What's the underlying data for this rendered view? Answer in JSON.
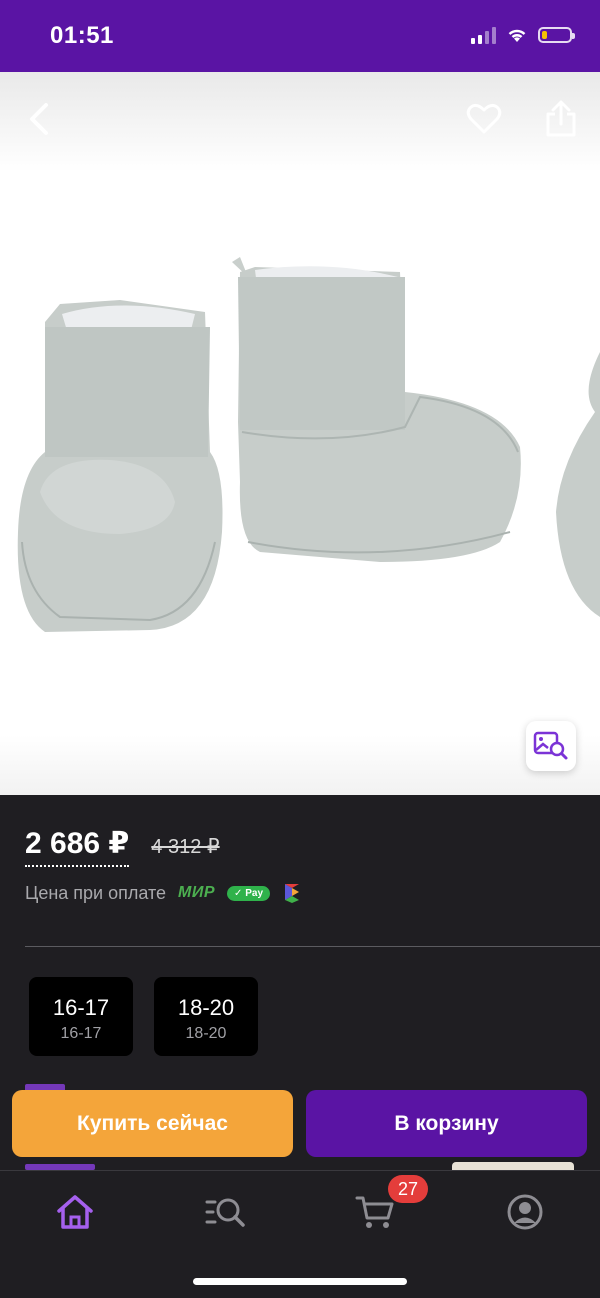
{
  "status_bar": {
    "time": "01:51",
    "battery_level": 0.2,
    "color": "#5a14a4"
  },
  "icons": {
    "back": "chevron-left-icon",
    "favorite": "heart-icon",
    "share": "share-icon",
    "visual_search": "image-search-icon",
    "tabs": [
      "home-icon",
      "catalog-search-icon",
      "cart-icon",
      "profile-icon"
    ]
  },
  "product": {
    "price_current": "2 686 ₽",
    "price_old": "4 312 ₽",
    "pay_caption": "Цена при оплате",
    "payment_methods": {
      "mir": "МИР",
      "sbp_pay": "Pay"
    }
  },
  "sizes": [
    {
      "label": "16-17",
      "sublabel": "16-17"
    },
    {
      "label": "18-20",
      "sublabel": "18-20"
    }
  ],
  "actions": {
    "buy_now": "Купить сейчас",
    "add_to_cart": "В корзину"
  },
  "tab_bar": {
    "cart_count": "27",
    "active_tab": "home"
  },
  "colors": {
    "accent": "#5a14a4",
    "buy_now": "#f4a53a",
    "badge": "#e43d3b",
    "active_tab": "#a560ee"
  }
}
